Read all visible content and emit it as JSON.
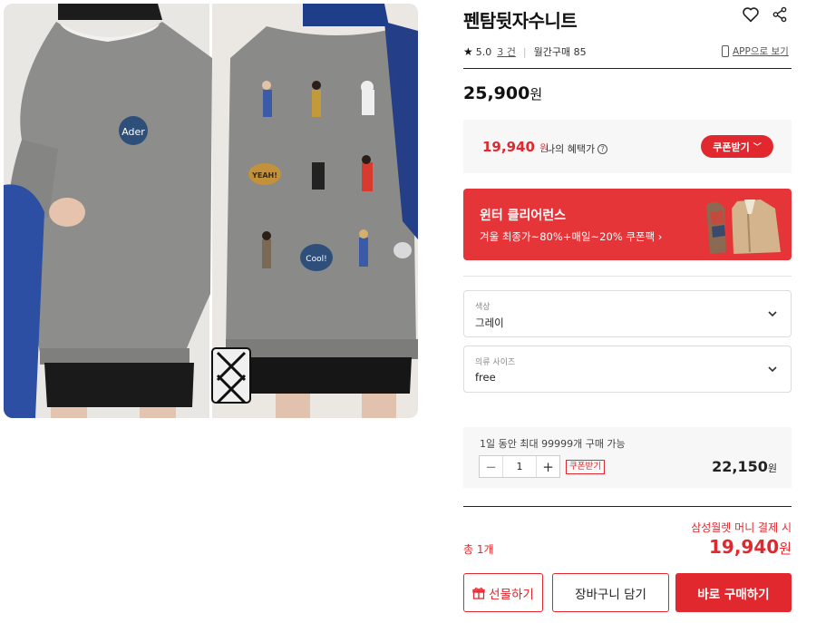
{
  "product": {
    "title": "펜탐뒷자수니트",
    "rating": "5.0",
    "review_count": "3 건",
    "monthly_purchases": "월간구매 85",
    "app_link": "APP으로 보기",
    "price": "25,900",
    "currency": "원"
  },
  "image_embroidery_labels": {
    "left": "Ader",
    "right_top": "YEAH!",
    "right_bottom": "Cool!"
  },
  "benefit": {
    "price": "19,940",
    "currency": "원",
    "label": "나의 혜택가",
    "help": "?",
    "coupon_button": "쿠폰받기"
  },
  "banner": {
    "title": "윈터 클리어런스",
    "subtitle": "겨울 최종가~80%+매일~20% 쿠폰팩 ›"
  },
  "options": [
    {
      "label": "색상",
      "value": "그레이"
    },
    {
      "label": "의류 사이즈",
      "value": "free"
    }
  ],
  "quantity": {
    "limit_text": "1일 동안 최대 99999개 구매 가능",
    "minus": "−",
    "value": "1",
    "plus": "+",
    "coupon_tag": "쿠폰받기",
    "line_total": "22,150",
    "currency": "원"
  },
  "summary": {
    "payment_note": "삼성월렛 머니 결제 시",
    "count": "총 1개",
    "total": "19,940",
    "currency": "원"
  },
  "actions": {
    "gift": "선물하기",
    "cart": "장바구니 담기",
    "buy": "바로 구매하기"
  },
  "colors": {
    "accent": "#e0282e",
    "sweater": "#8a8a88",
    "banner": "#e53538"
  }
}
